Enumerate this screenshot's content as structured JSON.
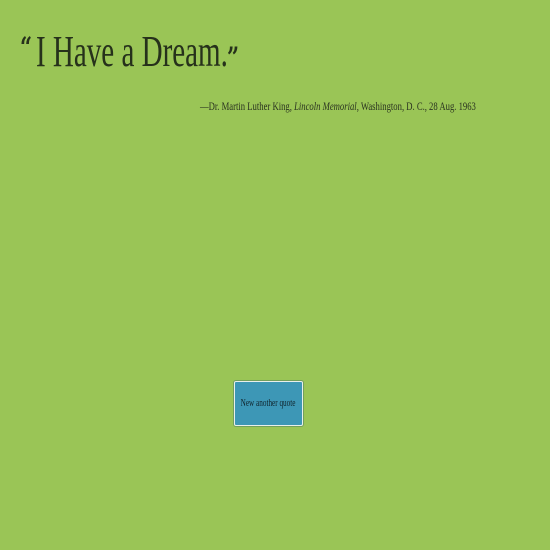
{
  "quote": {
    "open_mark": "“",
    "text": "I Have a Dream.",
    "close_mark": "”"
  },
  "attribution": {
    "prefix": "—Dr. Martin Luther King, ",
    "place": "Lincoln Memorial",
    "suffix": ", Washington, D. C., 28 Aug. 1963"
  },
  "button": {
    "label": "New another quote"
  },
  "colors": {
    "background": "#9ac556",
    "button": "#3d97b6",
    "text": "#26311b"
  }
}
